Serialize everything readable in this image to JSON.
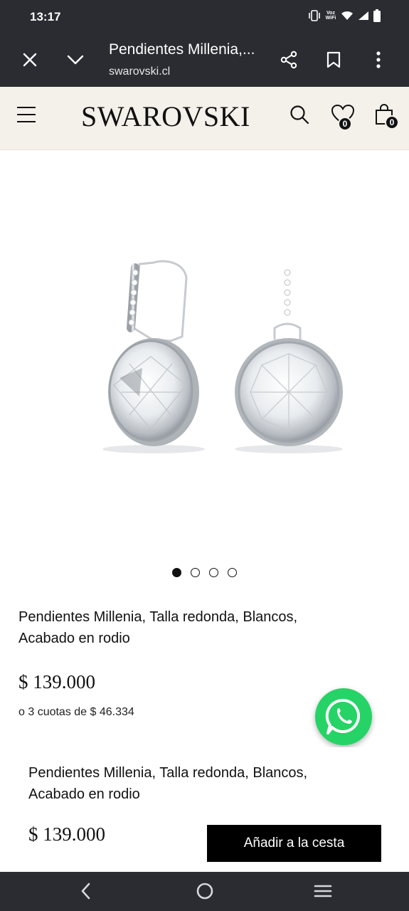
{
  "status_bar": {
    "time": "13:17",
    "volte_top": "Voz",
    "volte_bottom": "WiFi",
    "icons": [
      "vibrate-icon",
      "volte-icon",
      "wifi-icon",
      "signal-icon",
      "battery-icon"
    ]
  },
  "custom_tab": {
    "title": "Pendientes Millenia,...",
    "url": "swarovski.cl",
    "icons": [
      "close-icon",
      "chevron-down-icon",
      "share-icon",
      "bookmark-icon",
      "more-vert-icon"
    ]
  },
  "header": {
    "logo": "SWAROVSKI",
    "wishlist_count": "0",
    "cart_count": "0",
    "icons": [
      "menu-icon",
      "search-icon",
      "heart-icon",
      "shopping-bag-icon"
    ]
  },
  "product": {
    "name": "Pendientes Millenia, Talla redonda, Blancos, Acabado en rodio",
    "price": "$ 139.000",
    "installments": "o 3 cuotas de $ 46.334",
    "image_count": 4,
    "active_image": 1
  },
  "sticky_bar": {
    "name": "Pendientes Millenia, Talla redonda, Blancos, Acabado en rodio",
    "price": "$ 139.000",
    "add_to_cart": "Añadir a la cesta"
  },
  "colors": {
    "system_bar": "#2a2c31",
    "header_bg": "#f4f0ea",
    "whatsapp": "#25d366",
    "button": "#000000"
  }
}
